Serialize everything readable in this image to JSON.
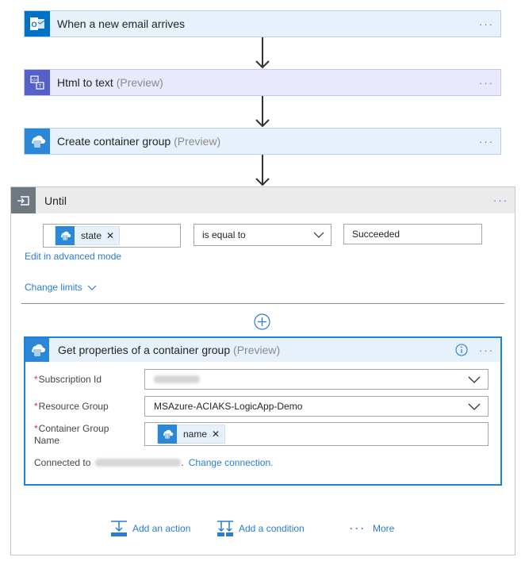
{
  "trigger": {
    "title": "When a new email arrives",
    "more": "···"
  },
  "html_to_text": {
    "title": "Html to text",
    "tag": "(Preview)",
    "more": "···"
  },
  "create_container": {
    "title": "Create container group",
    "tag": "(Preview)",
    "more": "···"
  },
  "until": {
    "title": "Until",
    "more": "···",
    "condition": {
      "left_token": "state",
      "operator": "is equal to",
      "value": "Succeeded"
    },
    "edit_advanced": "Edit in advanced mode",
    "change_limits": "Change limits"
  },
  "get_properties": {
    "title": "Get properties of a container group",
    "tag": "(Preview)",
    "more": "···",
    "fields": {
      "subscription_label": "Subscription Id",
      "resource_group_label": "Resource Group",
      "resource_group_value": "MSAzure-ACIAKS-LogicApp-Demo",
      "container_name_label_1": "Container Group",
      "container_name_label_2": "Name",
      "container_name_token": "name"
    },
    "connected_to": "Connected to",
    "change_connection": "Change connection."
  },
  "footer": {
    "add_action": "Add an action",
    "add_condition": "Add a condition",
    "more": "More"
  },
  "colors": {
    "accent": "#2b7cd3",
    "card_bg": "#e6f1fb",
    "required": "#d13438"
  }
}
